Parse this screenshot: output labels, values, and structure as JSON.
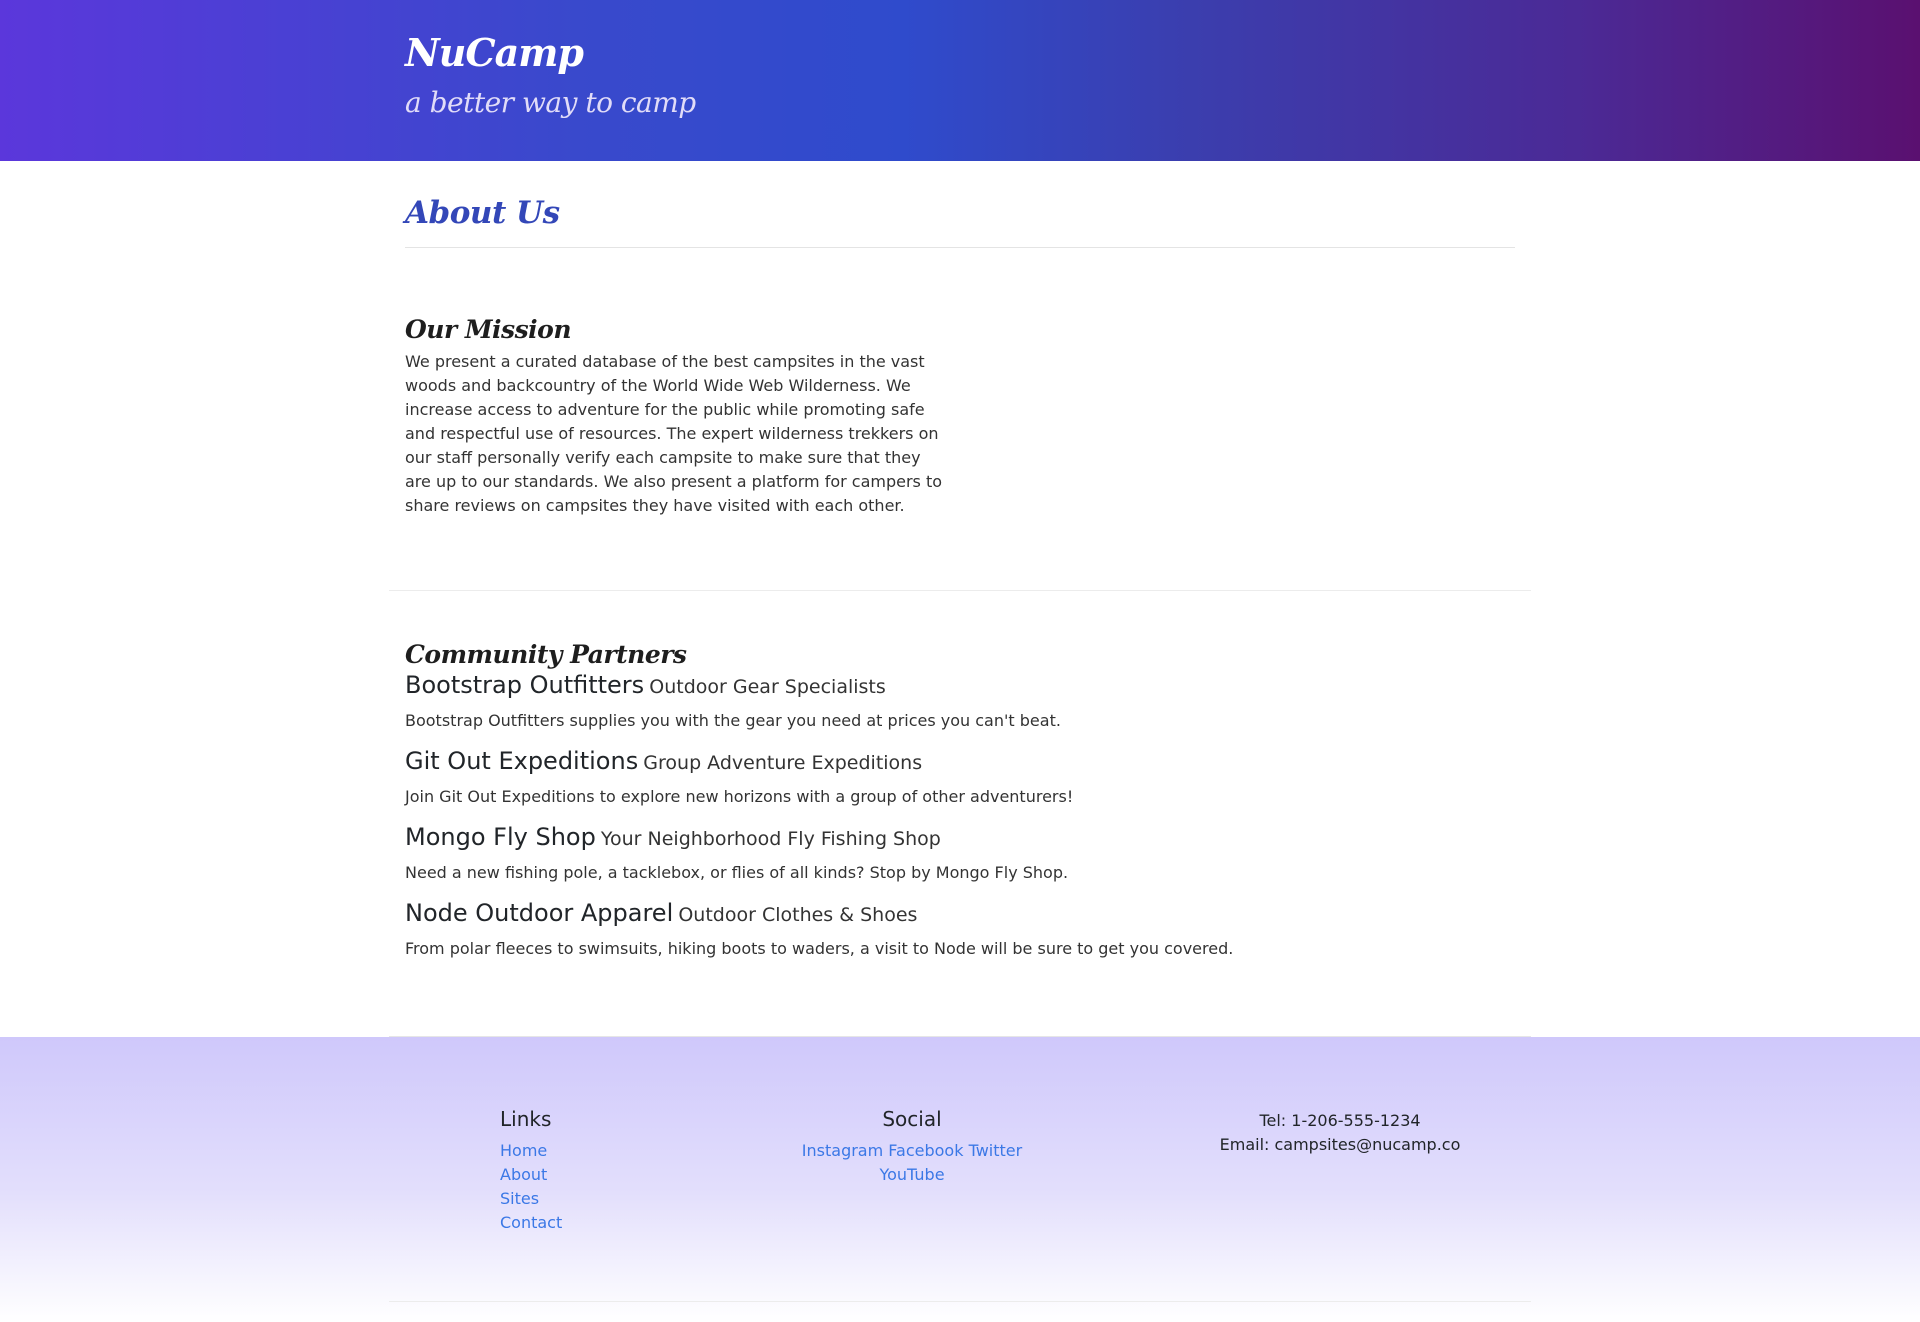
{
  "header": {
    "brand": "NuCamp",
    "tagline": "a better way to camp"
  },
  "page": {
    "title": "About Us"
  },
  "mission": {
    "heading": "Our Mission",
    "text": "We present a curated database of the best campsites in the vast woods and backcountry of the World Wide Web Wilderness. We increase access to adventure for the public while promoting safe and respectful use of resources. The expert wilderness trekkers on our staff personally verify each campsite to make sure that they are up to our standards. We also present a platform for campers to share reviews on campsites they have visited with each other."
  },
  "partners": {
    "heading": "Community Partners",
    "items": [
      {
        "name": "Bootstrap Outfitters",
        "subtitle": "Outdoor Gear Specialists",
        "description": "Bootstrap Outfitters supplies you with the gear you need at prices you can't beat."
      },
      {
        "name": "Git Out Expeditions",
        "subtitle": "Group Adventure Expeditions",
        "description": "Join Git Out Expeditions to explore new horizons with a group of other adventurers!"
      },
      {
        "name": "Mongo Fly Shop",
        "subtitle": "Your Neighborhood Fly Fishing Shop",
        "description": "Need a new fishing pole, a tacklebox, or flies of all kinds? Stop by Mongo Fly Shop."
      },
      {
        "name": "Node Outdoor Apparel",
        "subtitle": "Outdoor Clothes & Shoes",
        "description": "From polar fleeces to swimsuits, hiking boots to waders, a visit to Node will be sure to get you covered."
      }
    ]
  },
  "footer": {
    "links": {
      "heading": "Links",
      "items": [
        "Home",
        "About",
        "Sites",
        "Contact"
      ]
    },
    "social": {
      "heading": "Social",
      "items": [
        "Instagram",
        "Facebook",
        "Twitter",
        "YouTube"
      ]
    },
    "contact": {
      "tel": "Tel: 1-206-555-1234",
      "email": "Email: campsites@nucamp.co"
    }
  },
  "colors": {
    "accent": "#3347b8",
    "link": "#3b78e6"
  }
}
